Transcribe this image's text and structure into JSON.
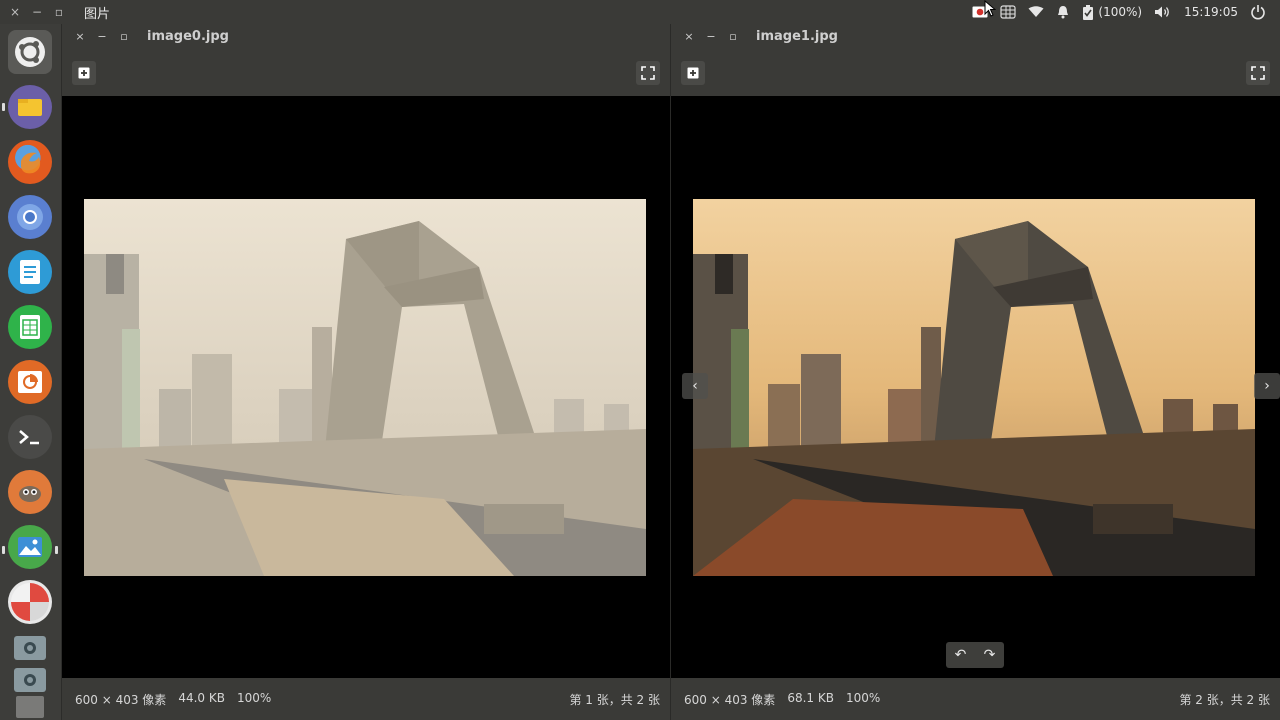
{
  "system": {
    "app_title": "图片",
    "battery": "(100%)",
    "time": "15:19:05"
  },
  "window_controls": {
    "close": "×",
    "minimize": "−",
    "maximize": "▫"
  },
  "launcher": {
    "items": [
      {
        "name": "ubuntu-dash",
        "color": "#6a6a67"
      },
      {
        "name": "files",
        "color": "#6b5fa8"
      },
      {
        "name": "firefox",
        "color": "#d9502a"
      },
      {
        "name": "chromium",
        "color": "#5a7fd0"
      },
      {
        "name": "writer",
        "color": "#2e9bd6"
      },
      {
        "name": "calc",
        "color": "#2fb34a"
      },
      {
        "name": "impress",
        "color": "#e06a26"
      },
      {
        "name": "terminal",
        "color": "#4a4a48"
      },
      {
        "name": "gimp",
        "color": "#e07a3a"
      },
      {
        "name": "image-viewer",
        "color": "#48a84a"
      },
      {
        "name": "disk-usage",
        "color": "#e04040"
      },
      {
        "name": "extra-app",
        "color": "#8a9aa0"
      },
      {
        "name": "extra-app-2",
        "color": "#8a9aa0"
      }
    ]
  },
  "panes": [
    {
      "title": "image0.jpg",
      "dimensions": "600 × 403 像素",
      "size": "44.0 KB",
      "zoom": "100%",
      "position": "第 1 张，共 2 张"
    },
    {
      "title": "image1.jpg",
      "dimensions": "600 × 403 像素",
      "size": "68.1 KB",
      "zoom": "100%",
      "position": "第 2 张，共 2 张"
    }
  ],
  "nav": {
    "prev": "‹",
    "next": "›",
    "rotate_left": "↶",
    "rotate_right": "↷"
  }
}
